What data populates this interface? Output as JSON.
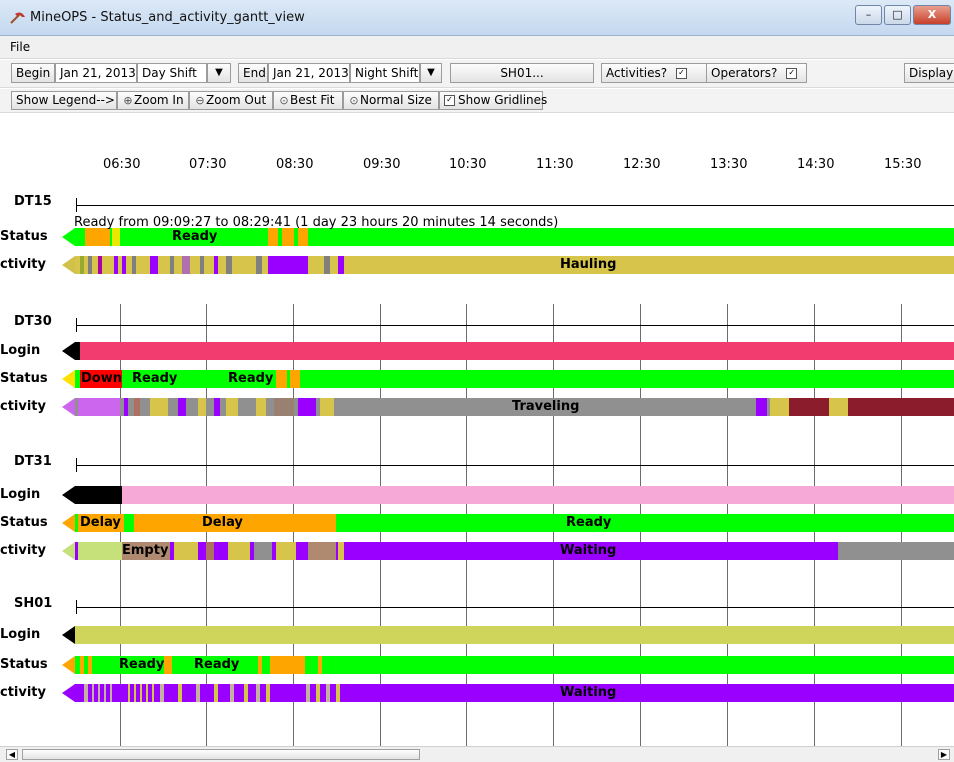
{
  "window": {
    "title": "MineOPS - Status_and_activity_gantt_view",
    "minimize": "–",
    "maximize": "□",
    "close": "X"
  },
  "menu": {
    "file": "File"
  },
  "toolbar": {
    "begin_label": "Begin",
    "begin_date": "Jan 21, 2013",
    "begin_shift": "Day Shift",
    "end_label": "End",
    "end_date": "Jan 21, 2013",
    "end_shift": "Night Shift",
    "equipment_filter": "SH01...",
    "activities_label": "Activities?",
    "activities_checked": true,
    "operators_label": "Operators?",
    "operators_checked": true,
    "display_label": "Display"
  },
  "toolbar2": {
    "show_legend": "Show Legend-->",
    "zoom_in": "Zoom In",
    "zoom_out": "Zoom Out",
    "best_fit": "Best Fit",
    "normal_size": "Normal Size",
    "show_gridlines": "Show Gridlines",
    "gridlines_checked": true
  },
  "icons": {
    "app": "pickaxe-icon",
    "magnifier": "magnifier-icon",
    "dropdown": "chevron-down-icon"
  },
  "timeline": {
    "hours": [
      "06:30",
      "07:30",
      "08:30",
      "09:30",
      "10:30",
      "11:30",
      "12:30",
      "13:30",
      "14:30",
      "15:30"
    ]
  },
  "info_text": "Ready from 09:09:27 to 08:29:41 (1 day 23 hours 20 minutes 14 seconds)",
  "colors": {
    "ready": "#00ff00",
    "delay": "#ffa500",
    "down": "#ff0000",
    "login_dt30": "#f23b6e",
    "login_dt31": "#f6a8d6",
    "login_sh01": "#cfd45b",
    "hauling": "#d7c44a",
    "traveling": "#909090",
    "waiting": "#9a00ff",
    "empty": "#c6e07a"
  },
  "groups": [
    {
      "id": "DT15",
      "rows": [
        {
          "label": "Status",
          "segments": [
            {
              "text": "Ready",
              "state": "ready"
            }
          ]
        },
        {
          "label": "ctivity",
          "segments": [
            {
              "text": "Hauling",
              "state": "hauling"
            }
          ]
        }
      ]
    },
    {
      "id": "DT30",
      "rows": [
        {
          "label": "Login",
          "segments": []
        },
        {
          "label": "Status",
          "segments": [
            {
              "text": "Down",
              "state": "down"
            },
            {
              "text": "Ready",
              "state": "ready"
            },
            {
              "text": "Ready",
              "state": "ready"
            }
          ]
        },
        {
          "label": "ctivity",
          "segments": [
            {
              "text": "Traveling",
              "state": "traveling"
            }
          ]
        }
      ]
    },
    {
      "id": "DT31",
      "rows": [
        {
          "label": "Login",
          "segments": []
        },
        {
          "label": "Status",
          "segments": [
            {
              "text": "Delay",
              "state": "delay"
            },
            {
              "text": "Delay",
              "state": "delay"
            },
            {
              "text": "Ready",
              "state": "ready"
            }
          ]
        },
        {
          "label": "ctivity",
          "segments": [
            {
              "text": "Empty",
              "state": "empty"
            },
            {
              "text": "Waiting",
              "state": "waiting"
            }
          ]
        }
      ]
    },
    {
      "id": "SH01",
      "rows": [
        {
          "label": "Login",
          "segments": []
        },
        {
          "label": "Status",
          "segments": [
            {
              "text": "Ready",
              "state": "ready"
            },
            {
              "text": "Ready",
              "state": "ready"
            }
          ]
        },
        {
          "label": "ctivity",
          "segments": [
            {
              "text": "Waiting",
              "state": "waiting"
            }
          ]
        }
      ]
    }
  ]
}
